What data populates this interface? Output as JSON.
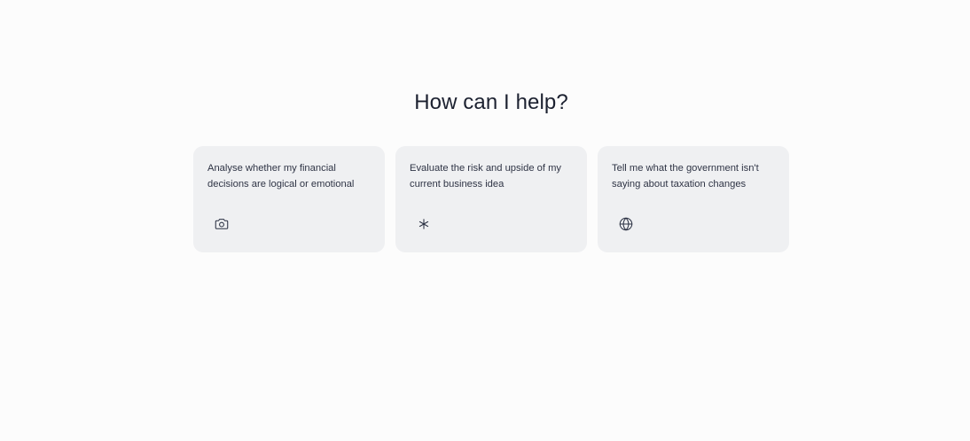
{
  "main": {
    "heading": "How can I help?",
    "suggestions": [
      {
        "text": "Analyse whether my financial decisions are logical or emotional",
        "icon": "camera-icon"
      },
      {
        "text": "Evaluate the risk and upside of my current business idea",
        "icon": "asterisk-icon"
      },
      {
        "text": "Tell me what the government isn't saying about taxation changes",
        "icon": "globe-icon"
      }
    ]
  }
}
